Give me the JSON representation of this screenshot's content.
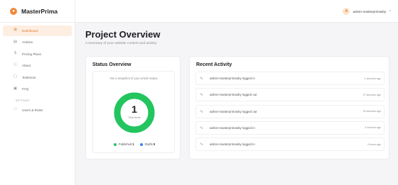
{
  "app": {
    "name": "MasterPrima",
    "logo_letter": "●"
  },
  "sidebar": {
    "items": [
      {
        "label": "Dashboard",
        "icon": "grid-icon",
        "glyph": "⊞",
        "active": true
      },
      {
        "label": "Articles",
        "icon": "article-icon",
        "glyph": "▤",
        "active": false
      },
      {
        "label": "Pricing Plans",
        "icon": "dollar-icon",
        "glyph": "$",
        "active": false
      },
      {
        "label": "About",
        "icon": "info-icon",
        "glyph": "ⓘ",
        "active": false
      },
      {
        "label": "Testimoni",
        "icon": "comment-icon",
        "glyph": "▢",
        "active": false
      },
      {
        "label": "FAQ",
        "icon": "faq-icon",
        "glyph": "▣",
        "active": false
      }
    ],
    "section_settings": "SETTINGS",
    "settings_items": [
      {
        "label": "Users & Roles",
        "icon": "users-icon",
        "glyph": "□"
      }
    ]
  },
  "header": {
    "user_initial": "A",
    "user_name": "admin-masterprimasby",
    "chevron": "˅"
  },
  "page": {
    "title": "Project Overview",
    "subtitle": "A summary of your website content and activity."
  },
  "status": {
    "title": "Status Overview",
    "snapshot": "Get a snapshot of your article status",
    "total": "1",
    "total_label": "Total Items",
    "published_label": "Published",
    "published_value": "1",
    "drafts_label": "Drafts",
    "drafts_value": "0",
    "published_fraction": 1.0,
    "colors": {
      "published": "#22c55e",
      "drafts": "#3b82f6"
    }
  },
  "activity": {
    "title": "Recent Activity",
    "icon": "activity-icon",
    "glyph": "∿",
    "items": [
      {
        "text": "admin-masterprimasby logged in",
        "time": "1 seconds ago"
      },
      {
        "text": "admin-masterprimasby logged out",
        "time": "37 seconds ago"
      },
      {
        "text": "admin-masterprimasby logged out",
        "time": "40 seconds ago"
      },
      {
        "text": "admin-masterprimasby logged in",
        "time": "4 minutes ago"
      },
      {
        "text": "admin-masterprimasby logged in",
        "time": "4 hours ago"
      }
    ]
  }
}
